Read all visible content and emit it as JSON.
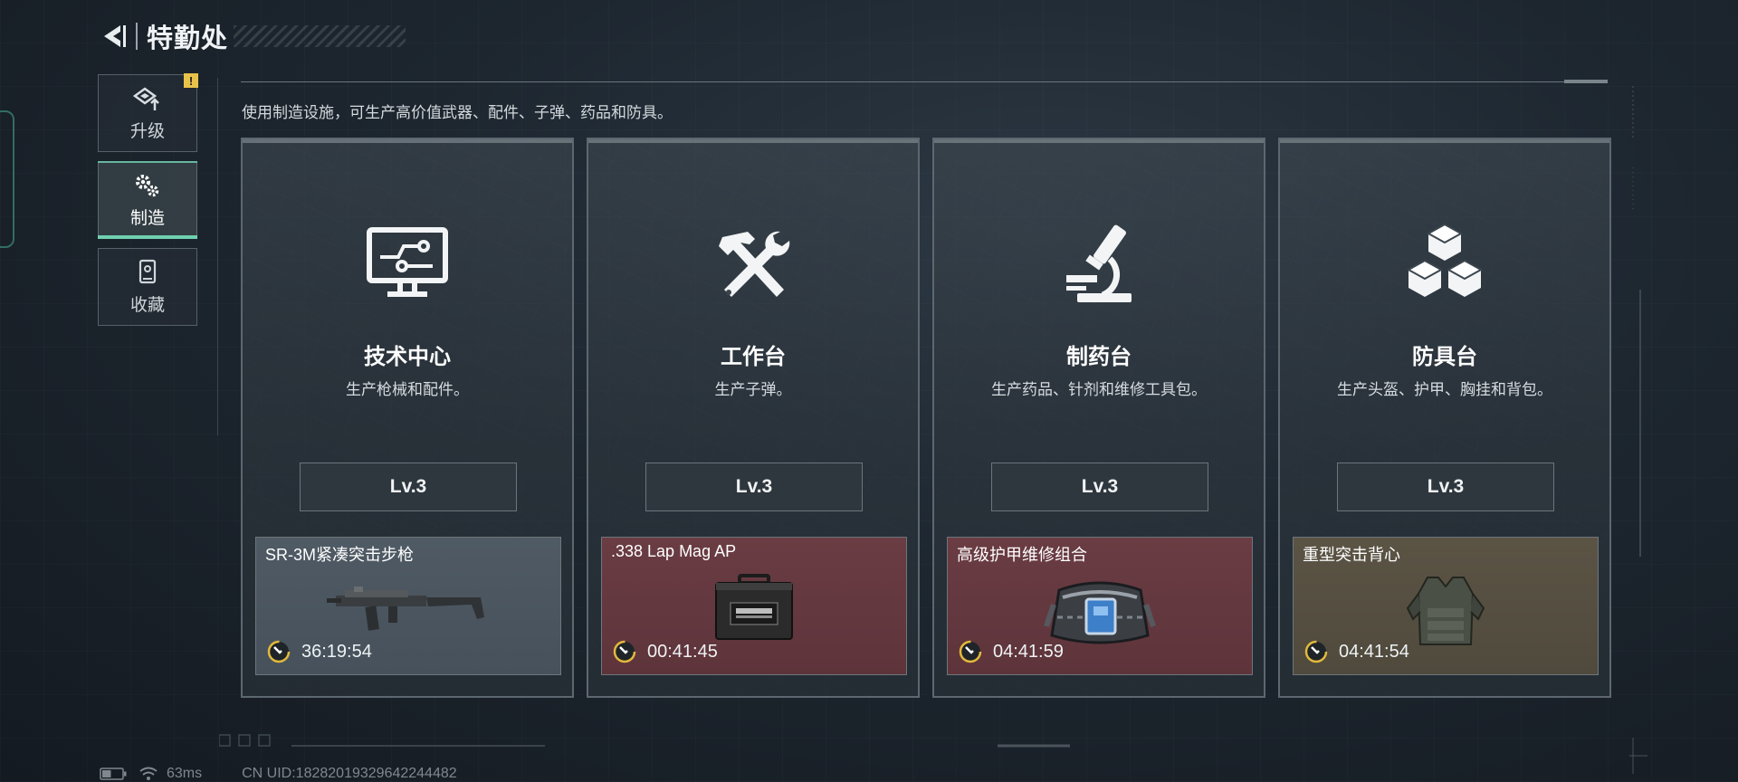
{
  "header": {
    "title": "特勤处"
  },
  "sidebar": {
    "items": [
      {
        "label": "升级",
        "icon": "upgrade-icon",
        "active": false,
        "alert": "!"
      },
      {
        "label": "制造",
        "icon": "crafting-gears-icon",
        "active": true
      },
      {
        "label": "收藏",
        "icon": "collection-icon",
        "active": false
      }
    ]
  },
  "main": {
    "description": "使用制造设施，可生产高价值武器、配件、子弹、药品和防具。",
    "stations": [
      {
        "name": "技术中心",
        "desc": "生产枪械和配件。",
        "level": "Lv.3",
        "icon": "monitor-circuit-icon",
        "job": {
          "item": "SR-3M紧凑突击步枪",
          "timer": "36:19:54",
          "tone": "gray",
          "image": "rifle-icon"
        }
      },
      {
        "name": "工作台",
        "desc": "生产子弹。",
        "level": "Lv.3",
        "icon": "hammer-wrench-icon",
        "job": {
          "item": ".338 Lap Mag AP",
          "timer": "00:41:45",
          "tone": "red",
          "image": "ammo-case-icon"
        }
      },
      {
        "name": "制药台",
        "desc": "生产药品、针剂和维修工具包。",
        "level": "Lv.3",
        "icon": "microscope-icon",
        "job": {
          "item": "高级护甲维修组合",
          "timer": "04:41:59",
          "tone": "red",
          "image": "repair-bag-icon"
        }
      },
      {
        "name": "防具台",
        "desc": "生产头盔、护甲、胸挂和背包。",
        "level": "Lv.3",
        "icon": "cubes-icon",
        "job": {
          "item": "重型突击背心",
          "timer": "04:41:54",
          "tone": "olive",
          "image": "armor-vest-icon"
        }
      }
    ]
  },
  "status": {
    "ping": "63ms",
    "uid": "CN UID:18282019329642244482",
    "battery": 0.45
  },
  "colors": {
    "accent": "#6fd0b0",
    "alert": "#e9c24a",
    "timer_ring": "#e3b93c"
  }
}
